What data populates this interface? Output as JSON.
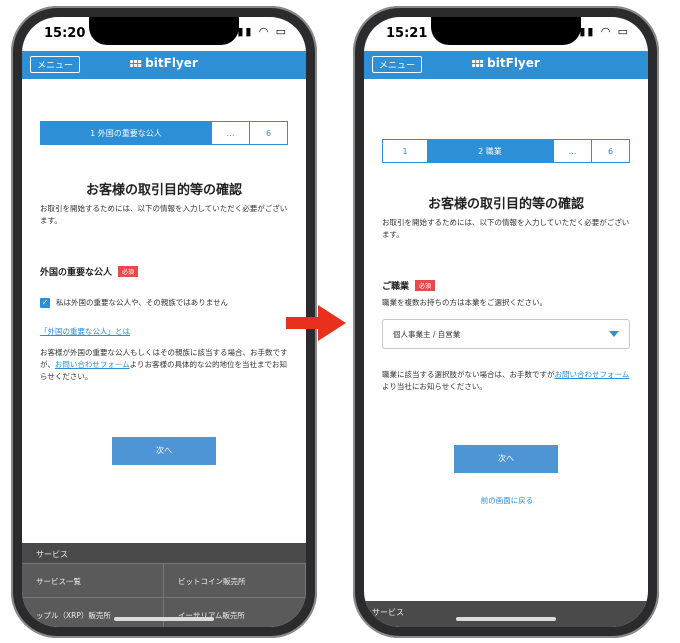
{
  "colors": {
    "accent": "#2d8fd5",
    "required": "#e14c4c",
    "arrow": "#e8301c"
  },
  "left": {
    "status": {
      "time": "15:20 ➤",
      "icons": "▮▮▮ ◠ ▭"
    },
    "menu": "メニュー",
    "brand": "bitFlyer",
    "steps": [
      "1 外国の重要な公人",
      "…",
      "6"
    ],
    "title": "お客様の取引目的等の確認",
    "intro": "お取引を開始するためには、以下の情報を入力していただく必要がございます。",
    "section_title": "外国の重要な公人",
    "required": "必須",
    "checkbox_label": "私は外国の重要な公人や、その親族ではありません",
    "checkbox_checked": true,
    "link": "「外国の重要な公人」とは",
    "note_pre": "お客様が外国の重要な公人もしくはその親族に該当する場合、お手数ですが、",
    "note_link": "お問い合わせフォーム",
    "note_post": "よりお客様の具体的な公的地位を当社までお知らせください。",
    "next": "次へ",
    "footer": {
      "header": "サービス",
      "items": [
        "サービス一覧",
        "ビットコイン販売所",
        "ップル（XRP）販売所",
        "イーサリアム販売所"
      ]
    }
  },
  "right": {
    "status": {
      "time": "15:21 ➤",
      "icons": "▮▮▮ ◠ ▭"
    },
    "menu": "メニュー",
    "brand": "bitFlyer",
    "steps": [
      "1",
      "2 職業",
      "…",
      "6"
    ],
    "title": "お客様の取引目的等の確認",
    "intro": "お取引を開始するためには、以下の情報を入力していただく必要がございます。",
    "section_title": "ご職業",
    "required": "必須",
    "hint": "職業を複数お持ちの方は本業をご選択ください。",
    "select_value": "個人事業主 / 自営業",
    "note_pre": "職業に該当する選択肢がない場合は、お手数ですが",
    "note_link": "お問い合わせフォーム",
    "note_post": "より当社にお知らせください。",
    "next": "次へ",
    "back": "前の画面に戻る",
    "footer": {
      "header": "サービス"
    }
  }
}
